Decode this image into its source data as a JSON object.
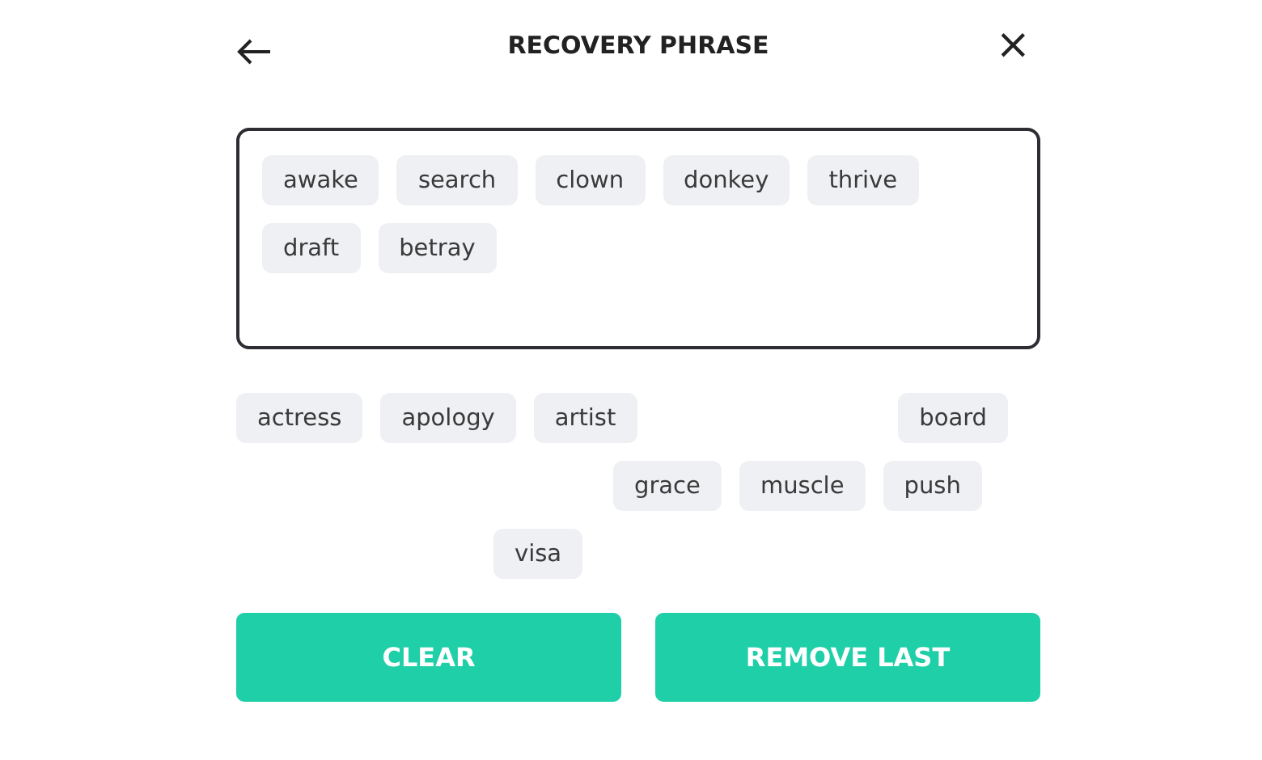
{
  "header": {
    "title": "RECOVERY PHRASE",
    "close": "×"
  },
  "selected_words": [
    "awake",
    "search",
    "clown",
    "donkey",
    "thrive",
    "draft",
    "betray"
  ],
  "word_pool": [
    [
      "actress",
      "apology",
      "artist",
      "board"
    ],
    [
      "grace",
      "muscle",
      "push"
    ],
    [
      "visa"
    ]
  ],
  "buttons": [
    "CLEAR",
    "REMOVE LAST"
  ]
}
